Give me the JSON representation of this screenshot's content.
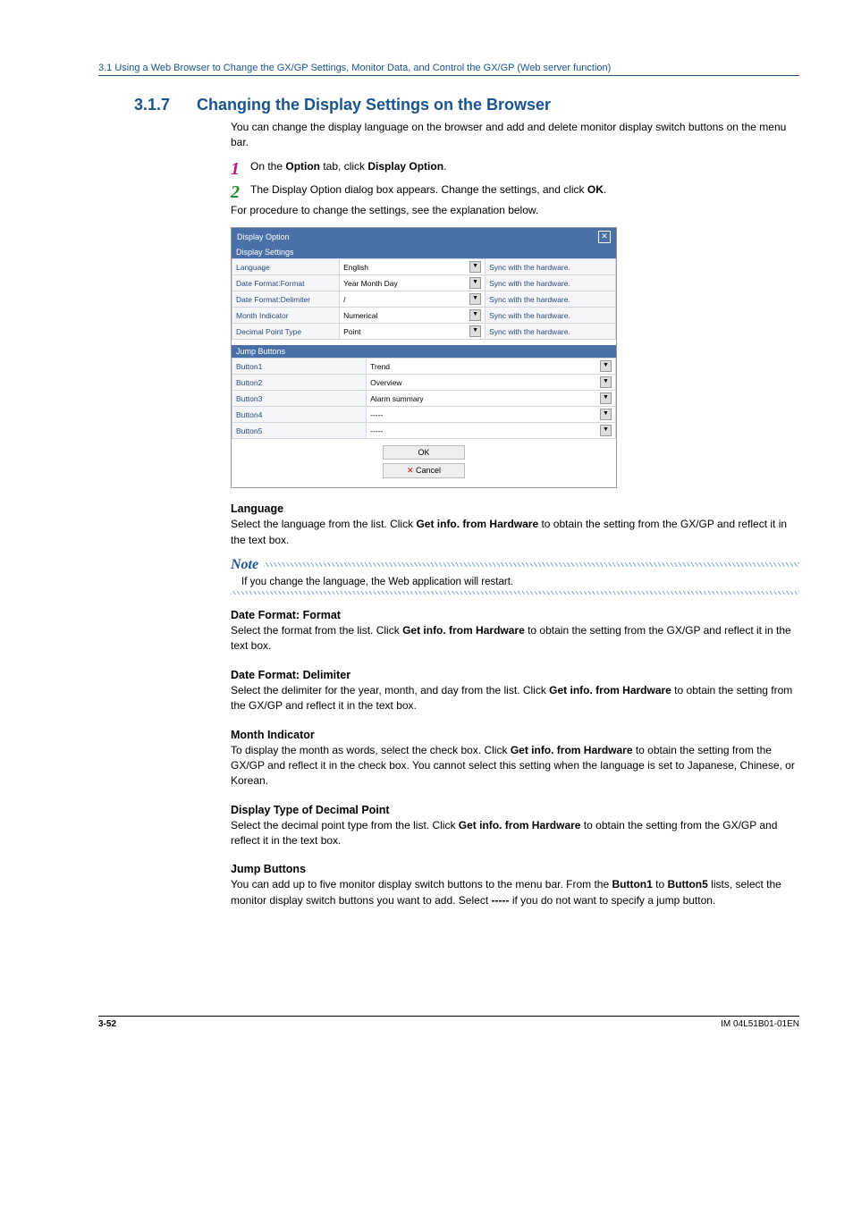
{
  "header": "3.1  Using a Web Browser to Change the GX/GP Settings, Monitor Data, and Control the GX/GP (Web server function)",
  "section": {
    "num": "3.1.7",
    "title": "Changing the Display Settings on the Browser"
  },
  "intro": "You can change the display language on the browser and add and delete monitor display switch buttons on the menu bar.",
  "steps": {
    "s1a": "On the ",
    "s1b": "Option",
    "s1c": " tab, click ",
    "s1d": "Display Option",
    "s1e": ".",
    "s2a": "The Display Option dialog box appears. Change the settings, and click ",
    "s2b": "OK",
    "s2c": ".",
    "s2line2": "For procedure to change the settings, see the explanation below."
  },
  "dlg": {
    "title": "Display Option",
    "sect1": "Display Settings",
    "rows1": [
      {
        "l": "Language",
        "v": "English",
        "a": "Sync with the hardware."
      },
      {
        "l": "Date Format:Format",
        "v": "Year Month Day",
        "a": "Sync with the hardware."
      },
      {
        "l": "Date Format:Delimiter",
        "v": "/",
        "a": "Sync with the hardware."
      },
      {
        "l": "Month Indicator",
        "v": "Numerical",
        "a": "Sync with the hardware."
      },
      {
        "l": "Decimal Point Type",
        "v": "Point",
        "a": "Sync with the hardware."
      }
    ],
    "sect2": "Jump Buttons",
    "rows2": [
      {
        "l": "Button1",
        "v": "Trend"
      },
      {
        "l": "Button2",
        "v": "Overview"
      },
      {
        "l": "Button3",
        "v": "Alarm summary"
      },
      {
        "l": "Button4",
        "v": "-----"
      },
      {
        "l": "Button5",
        "v": "-----"
      }
    ],
    "ok": "OK",
    "cancel": "Cancel",
    "x": "✕"
  },
  "lang": {
    "h": "Language",
    "p1": "Select the language from the list. Click ",
    "b": "Get info. from Hardware",
    "p2": " to obtain the setting from the GX/GP and reflect it in the text box."
  },
  "note": {
    "label": "Note",
    "text": "If you change the language, the Web application will restart."
  },
  "fmt": {
    "h": "Date Format: Format",
    "p1": "Select the format from the list. Click ",
    "b": "Get info. from Hardware",
    "p2": " to obtain the setting from the GX/GP and reflect it in the text box."
  },
  "delim": {
    "h": "Date Format: Delimiter",
    "p1": "Select the delimiter for the year, month, and day from the list. Click ",
    "b": "Get info. from Hardware",
    "p2": " to obtain the setting from the GX/GP and reflect it in the text box."
  },
  "month": {
    "h": "Month Indicator",
    "p1": "To display the month as words, select the check box. Click ",
    "b": "Get info. from Hardware",
    "p2": " to obtain the setting from the GX/GP and reflect it in the check box. You cannot select this setting when the language is set to Japanese, Chinese, or Korean."
  },
  "dec": {
    "h": "Display Type of Decimal Point",
    "p1": "Select the decimal point type from the list. Click ",
    "b": "Get info. from Hardware",
    "p2": " to obtain the setting from the GX/GP and reflect it in the text box."
  },
  "jump": {
    "h": "Jump Buttons",
    "p1": "You can add up to five monitor display switch buttons to the menu bar. From the ",
    "b1": "Button1",
    "p2": " to ",
    "b2": "Button5",
    "p3": " lists, select the monitor display switch buttons you want to add. Select ",
    "b3": "-----",
    "p4": " if you do not want to specify a jump button."
  },
  "footer": {
    "page": "3-52",
    "doc": "IM 04L51B01-01EN"
  }
}
